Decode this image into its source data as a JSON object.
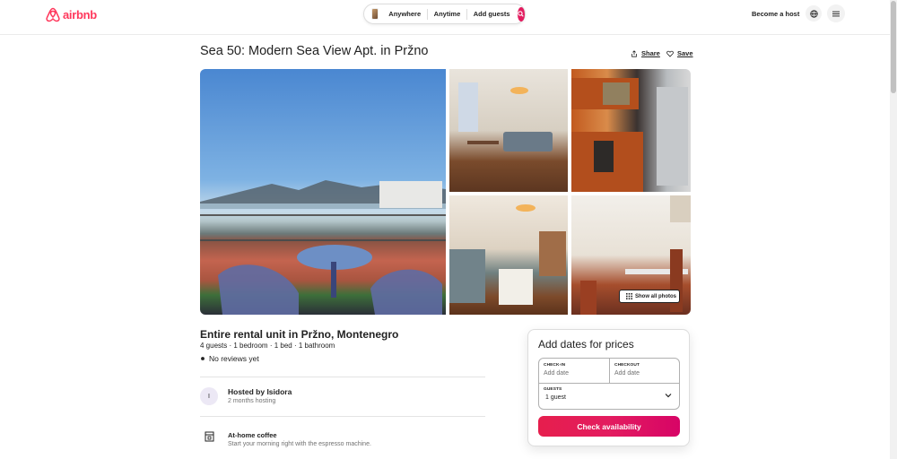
{
  "header": {
    "logo_text": "airbnb",
    "search": {
      "where": "Anywhere",
      "when": "Anytime",
      "who": "Add guests"
    },
    "become_host": "Become a host"
  },
  "listing": {
    "title": "Sea 50: Modern Sea View Apt. in Pržno",
    "share_label": "Share",
    "save_label": "Save",
    "show_all_photos": "Show all photos",
    "subtitle": "Entire rental unit in Pržno, Montenegro",
    "facts": "4 guests · 1 bedroom · 1 bed · 1 bathroom",
    "reviews": "No reviews yet",
    "host": {
      "initial": "I",
      "hosted_by": "Hosted by Isidora",
      "hosting_duration": "2 months hosting"
    },
    "amenity": {
      "title": "At-home coffee",
      "description": "Start your morning right with the espresso machine."
    }
  },
  "booking": {
    "title": "Add dates for prices",
    "checkin_label": "CHECK-IN",
    "checkin_value": "Add date",
    "checkout_label": "CHECKOUT",
    "checkout_value": "Add date",
    "guests_label": "GUESTS",
    "guests_value": "1 guest",
    "cta": "Check availability"
  },
  "colors": {
    "brand": "#ff385c",
    "cta": "#e31c5f"
  }
}
